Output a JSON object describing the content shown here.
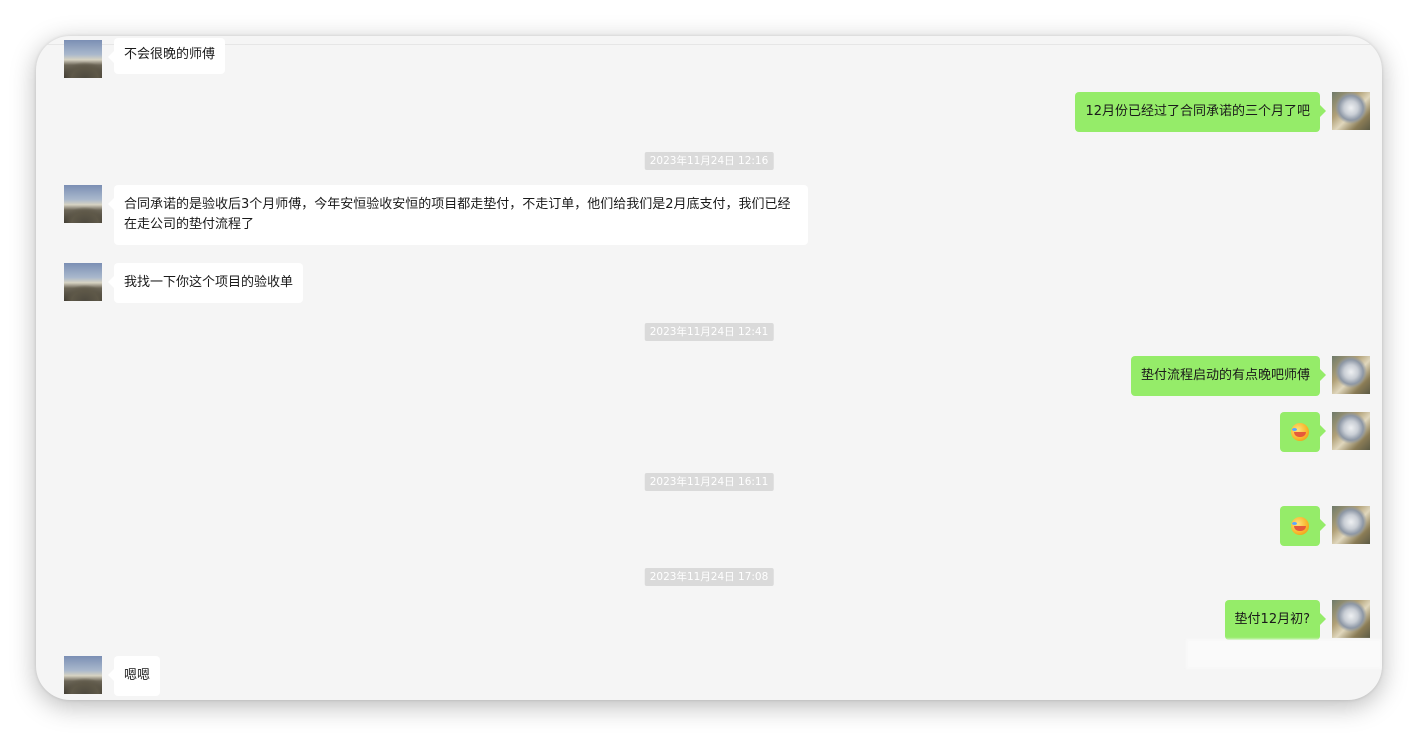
{
  "chat": {
    "messages": [
      {
        "side": "left",
        "text": "不会很晚的师傅"
      },
      {
        "side": "right",
        "text": "12月份已经过了合同承诺的三个月了吧"
      },
      {
        "timestamp": "2023年11月24日 12:16"
      },
      {
        "side": "left",
        "text": "合同承诺的是验收后3个月师傅，今年安恒验收安恒的项目都走垫付，不走订单，他们给我们是2月底支付，我们已经在走公司的垫付流程了"
      },
      {
        "side": "left",
        "text": "我找一下你这个项目的验收单"
      },
      {
        "timestamp": "2023年11月24日 12:41"
      },
      {
        "side": "right",
        "text": "垫付流程启动的有点晚吧师傅"
      },
      {
        "side": "right",
        "emoji": "laugh-cry-emoji"
      },
      {
        "timestamp": "2023年11月24日 16:11"
      },
      {
        "side": "right",
        "emoji": "laugh-cry-emoji"
      },
      {
        "timestamp": "2023年11月24日 17:08"
      },
      {
        "side": "right",
        "text": "垫付12月初?"
      },
      {
        "side": "left",
        "text": "嗯嗯"
      }
    ]
  },
  "colors": {
    "self_bubble": "#95ec69",
    "other_bubble": "#ffffff",
    "background": "#f5f5f5",
    "timestamp_bg": "#dadada"
  }
}
